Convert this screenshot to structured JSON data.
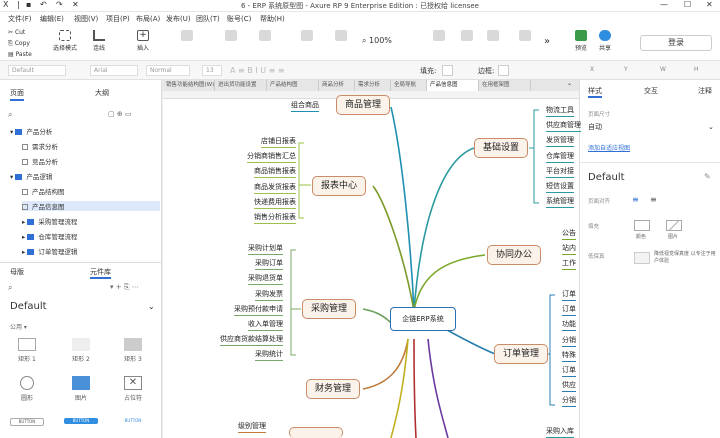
{
  "title": "6 - ERP 系统原型图 - Axure RP 9 Enterprise Edition : 已授权给 licensee",
  "menu": [
    "文件(F)",
    "编辑(E)",
    "视图(V)",
    "项目(P)",
    "布局(A)",
    "发布(U)",
    "团队(T)",
    "账号(C)",
    "帮助(H)"
  ],
  "toolbar": {
    "cut": "Cut",
    "copy": "Copy",
    "paste": "Paste",
    "select_mode": "选择模式",
    "connect": "连线",
    "insert": "插入",
    "zoom": "100%",
    "preview": "预览",
    "share": "共享",
    "login": "登录"
  },
  "format": {
    "style": "Default",
    "font": "Arial",
    "weight": "Normal",
    "size": "13",
    "fill": "填充:",
    "border": "边框:",
    "x": "X",
    "y": "Y",
    "w": "W",
    "h": "H"
  },
  "left": {
    "tabs": [
      "页面",
      "大纲"
    ],
    "tree": [
      {
        "label": "产品分析",
        "type": "folder",
        "indent": 0
      },
      {
        "label": "需求分析",
        "type": "page",
        "indent": 1
      },
      {
        "label": "竞品分析",
        "type": "page",
        "indent": 1
      },
      {
        "label": "产品逻辑",
        "type": "folder",
        "indent": 0
      },
      {
        "label": "产品结构图",
        "type": "page",
        "indent": 1
      },
      {
        "label": "产品信息图",
        "type": "page",
        "indent": 1,
        "active": true
      },
      {
        "label": "采购管理流程",
        "type": "folder",
        "indent": 1
      },
      {
        "label": "仓库管理流程",
        "type": "folder",
        "indent": 1
      },
      {
        "label": "订单管理逻辑",
        "type": "folder",
        "indent": 1
      }
    ],
    "lib_tabs": [
      "母版",
      "元件库"
    ],
    "lib_name": "Default",
    "lib_section": "公用 ▾",
    "widgets": [
      "矩形 1",
      "矩形 2",
      "矩形 3",
      "圆形",
      "图片",
      "占位符",
      "BUTTON",
      "BUTTON",
      "BUTTON"
    ]
  },
  "tabs": [
    "销售功能结构图(W)",
    "进出货功能设置",
    "产品结构图",
    "商品分析",
    "需求分析",
    "全局导航",
    "产品信息图",
    "在用框架图"
  ],
  "mindmap": {
    "center": "企链ERP系统",
    "nodes": {
      "goods": "商品管理",
      "report": "报表中心",
      "purchase": "采购管理",
      "finance": "财务管理",
      "basic": "基础设置",
      "collab": "协同办公",
      "order": "订单管理"
    },
    "goods_leaves": [
      "组合商品"
    ],
    "report_leaves": [
      "店铺日报表",
      "分销商销售汇总",
      "商品销售报表",
      "商品发货报表",
      "快递费用报表",
      "销售分析报表"
    ],
    "purchase_leaves": [
      "采购计划单",
      "采购订单",
      "采购退货单",
      "采购发票",
      "采购预付款申请",
      "收入单管理",
      "供应商货款结算处理",
      "采购统计"
    ],
    "finance_leaves": [
      "级别管理"
    ],
    "basic_leaves": [
      "物流工具",
      "供应商管理",
      "发货管理",
      "仓库管理",
      "平台对接",
      "短信设置",
      "系统管理"
    ],
    "collab_leaves": [
      "公告",
      "站内",
      "工作"
    ],
    "order_leaves": [
      "订单",
      "订单",
      "功能",
      "分销",
      "特殊",
      "订单",
      "供应",
      "分销"
    ],
    "bottom_leaves": [
      "采购入库"
    ]
  },
  "right": {
    "tabs": [
      "样式",
      "交互",
      "注释"
    ],
    "page_size_label": "页面尺寸",
    "page_size": "自动",
    "adaptive": "添加自适应视图",
    "style_name": "Default",
    "page_align": "页面对齐",
    "fill": "填充",
    "color": "颜色",
    "image": "图片",
    "low_fi": "低保真",
    "low_fi_desc": "降低视觉保真度 以专注于用户体验"
  }
}
